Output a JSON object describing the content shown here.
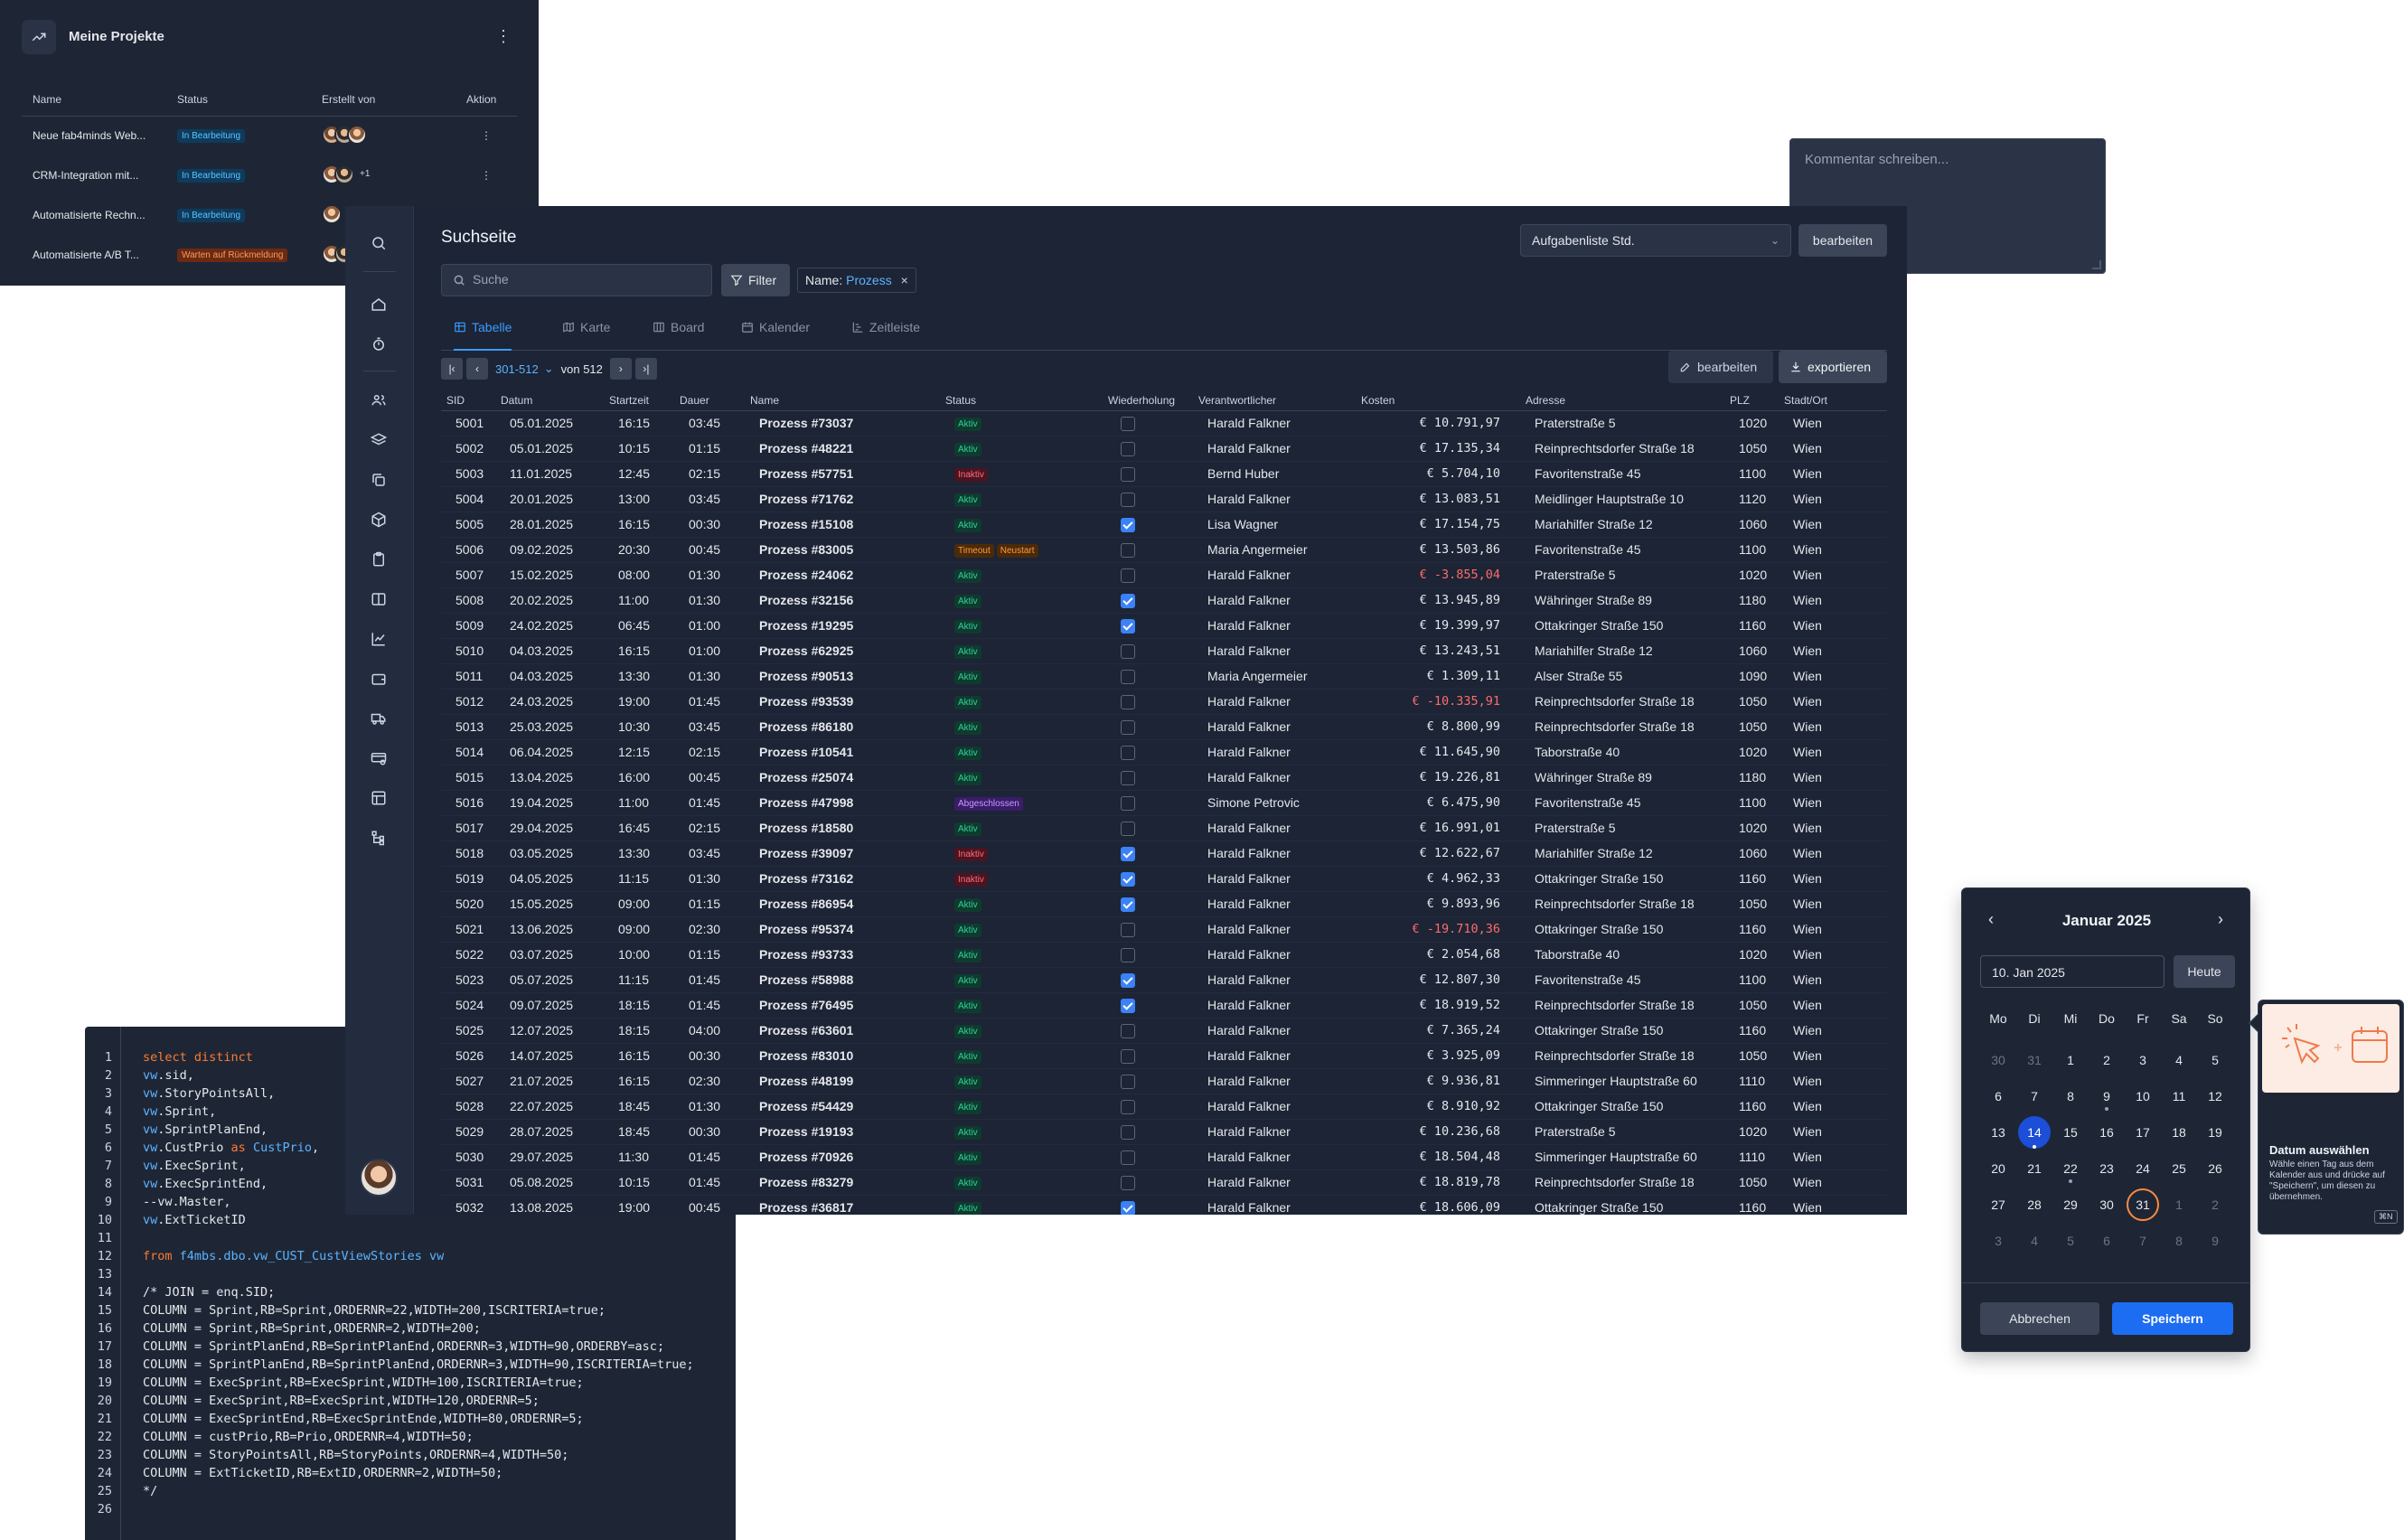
{
  "projects": {
    "title": "Meine Projekte",
    "columns": [
      "Name",
      "Status",
      "Erstellt von",
      "Aktion"
    ],
    "rows": [
      {
        "name": "Neue fab4minds Web...",
        "status": "In Bearbeitung",
        "status_color": "#5cc3ff",
        "more": ""
      },
      {
        "name": "CRM-Integration mit...",
        "status": "In Bearbeitung",
        "status_color": "#5cc3ff",
        "more": "+1"
      },
      {
        "name": "Automatisierte Rechn...",
        "status": "In Bearbeitung",
        "status_color": "#5cc3ff",
        "more": ""
      },
      {
        "name": "Automatisierte A/B T...",
        "status": "Warten auf Rückmeldung",
        "status_color": "#ff9a5c",
        "more": ""
      }
    ]
  },
  "comment": {
    "placeholder": "Kommentar schreiben..."
  },
  "code": {
    "lines": [
      [
        [
          "kw",
          "select distinct"
        ]
      ],
      [
        [
          "vw",
          "vw"
        ],
        [
          "t",
          ".sid,"
        ]
      ],
      [
        [
          "vw",
          "vw"
        ],
        [
          "t",
          ".StoryPointsAll,"
        ]
      ],
      [
        [
          "vw",
          "vw"
        ],
        [
          "t",
          ".Sprint,"
        ]
      ],
      [
        [
          "vw",
          "vw"
        ],
        [
          "t",
          ".SprintPlanEnd,"
        ]
      ],
      [
        [
          "vw",
          "vw"
        ],
        [
          "t",
          ".CustPrio "
        ],
        [
          "kw",
          "as"
        ],
        [
          "vw",
          " CustPrio"
        ],
        [
          "t",
          ","
        ]
      ],
      [
        [
          "vw",
          "vw"
        ],
        [
          "t",
          ".ExecSprint,"
        ]
      ],
      [
        [
          "vw",
          "vw"
        ],
        [
          "t",
          ".ExecSprintEnd,"
        ]
      ],
      [
        [
          "t",
          "--vw.Master,"
        ]
      ],
      [
        [
          "vw",
          "vw"
        ],
        [
          "t",
          ".ExtTicketID"
        ]
      ],
      [],
      [
        [
          "kw",
          "from "
        ],
        [
          "vw",
          "f4mbs.dbo.vw_CUST_CustViewStories vw"
        ]
      ],
      [],
      [
        [
          "t",
          "/* JOIN = enq.SID;"
        ]
      ],
      [
        [
          "t",
          "COLUMN = Sprint,RB=Sprint,ORDERNR=22,WIDTH=200,ISCRITERIA=true;"
        ]
      ],
      [
        [
          "t",
          "COLUMN = Sprint,RB=Sprint,ORDERNR=2,WIDTH=200;"
        ]
      ],
      [
        [
          "t",
          "COLUMN = SprintPlanEnd,RB=SprintPlanEnd,ORDERNR=3,WIDTH=90,ORDERBY=asc;"
        ]
      ],
      [
        [
          "t",
          "COLUMN = SprintPlanEnd,RB=SprintPlanEnd,ORDERNR=3,WIDTH=90,ISCRITERIA=true;"
        ]
      ],
      [
        [
          "t",
          "COLUMN = ExecSprint,RB=ExecSprint,WIDTH=100,ISCRITERIA=true;"
        ]
      ],
      [
        [
          "t",
          "COLUMN = ExecSprint,RB=ExecSprint,WIDTH=120,ORDERNR=5;"
        ]
      ],
      [
        [
          "t",
          "COLUMN = ExecSprintEnd,RB=ExecSprintEnde,WIDTH=80,ORDERNR=5;"
        ]
      ],
      [
        [
          "t",
          "COLUMN = custPrio,RB=Prio,ORDERNR=4,WIDTH=50;"
        ]
      ],
      [
        [
          "t",
          "COLUMN = StoryPointsAll,RB=StoryPoints,ORDERNR=4,WIDTH=50;"
        ]
      ],
      [
        [
          "t",
          "COLUMN = ExtTicketID,RB=ExtID,ORDERNR=2,WIDTH=50;"
        ]
      ],
      [
        [
          "t",
          "*/"
        ]
      ],
      []
    ]
  },
  "main": {
    "title": "Suchseite",
    "view_select": "Aufgabenliste Std.",
    "view_edit": "bearbeiten",
    "search_placeholder": "Suche",
    "filter_label": "Filter",
    "chip_key": "Name:",
    "chip_value": "Prozess",
    "chip_close": "×",
    "tabs": [
      "Tabelle",
      "Karte",
      "Board",
      "Kalender",
      "Zeitleiste"
    ],
    "pager": {
      "range": "301-512",
      "of": "von 512"
    },
    "edit_label": "bearbeiten",
    "export_label": "exportieren",
    "columns": [
      "SID",
      "Datum",
      "Startzeit",
      "Dauer",
      "Name",
      "Status",
      "Wiederholung",
      "Verantwortlicher",
      "Kosten",
      "Adresse",
      "PLZ",
      "Stadt/Ort"
    ],
    "rows": [
      [
        "5001",
        "05.01.2025",
        "16:15",
        "03:45",
        "Prozess #73037",
        [
          "Aktiv"
        ],
        false,
        "Harald Falkner",
        "€ 10.791,97",
        "Praterstraße 5",
        "1020",
        "Wien"
      ],
      [
        "5002",
        "05.01.2025",
        "10:15",
        "01:15",
        "Prozess #48221",
        [
          "Aktiv"
        ],
        false,
        "Harald Falkner",
        "€ 17.135,34",
        "Reinprechtsdorfer Straße 18",
        "1050",
        "Wien"
      ],
      [
        "5003",
        "11.01.2025",
        "12:45",
        "02:15",
        "Prozess #57751",
        [
          "Inaktiv"
        ],
        false,
        "Bernd Huber",
        "€ 5.704,10",
        "Favoritenstraße 45",
        "1100",
        "Wien"
      ],
      [
        "5004",
        "20.01.2025",
        "13:00",
        "03:45",
        "Prozess #71762",
        [
          "Aktiv"
        ],
        false,
        "Harald Falkner",
        "€ 13.083,51",
        "Meidlinger Hauptstraße 10",
        "1120",
        "Wien"
      ],
      [
        "5005",
        "28.01.2025",
        "16:15",
        "00:30",
        "Prozess #15108",
        [
          "Aktiv"
        ],
        true,
        "Lisa Wagner",
        "€ 17.154,75",
        "Mariahilfer Straße 12",
        "1060",
        "Wien"
      ],
      [
        "5006",
        "09.02.2025",
        "20:30",
        "00:45",
        "Prozess #83005",
        [
          "Timeout",
          "Neustart"
        ],
        false,
        "Maria Angermeier",
        "€ 13.503,86",
        "Favoritenstraße 45",
        "1100",
        "Wien"
      ],
      [
        "5007",
        "15.02.2025",
        "08:00",
        "01:30",
        "Prozess #24062",
        [
          "Aktiv"
        ],
        false,
        "Harald Falkner",
        "€ -3.855,04",
        "Praterstraße 5",
        "1020",
        "Wien"
      ],
      [
        "5008",
        "20.02.2025",
        "11:00",
        "01:30",
        "Prozess #32156",
        [
          "Aktiv"
        ],
        true,
        "Harald Falkner",
        "€ 13.945,89",
        "Währinger Straße 89",
        "1180",
        "Wien"
      ],
      [
        "5009",
        "24.02.2025",
        "06:45",
        "01:00",
        "Prozess #19295",
        [
          "Aktiv"
        ],
        true,
        "Harald Falkner",
        "€ 19.399,97",
        "Ottakringer Straße 150",
        "1160",
        "Wien"
      ],
      [
        "5010",
        "04.03.2025",
        "16:15",
        "01:00",
        "Prozess #62925",
        [
          "Aktiv"
        ],
        false,
        "Harald Falkner",
        "€ 13.243,51",
        "Mariahilfer Straße 12",
        "1060",
        "Wien"
      ],
      [
        "5011",
        "04.03.2025",
        "13:30",
        "01:30",
        "Prozess #90513",
        [
          "Aktiv"
        ],
        false,
        "Maria Angermeier",
        "€ 1.309,11",
        "Alser Straße 55",
        "1090",
        "Wien"
      ],
      [
        "5012",
        "24.03.2025",
        "19:00",
        "01:45",
        "Prozess #93539",
        [
          "Aktiv"
        ],
        false,
        "Harald Falkner",
        "€ -10.335,91",
        "Reinprechtsdorfer Straße 18",
        "1050",
        "Wien"
      ],
      [
        "5013",
        "25.03.2025",
        "10:30",
        "03:45",
        "Prozess #86180",
        [
          "Aktiv"
        ],
        false,
        "Harald Falkner",
        "€ 8.800,99",
        "Reinprechtsdorfer Straße 18",
        "1050",
        "Wien"
      ],
      [
        "5014",
        "06.04.2025",
        "12:15",
        "02:15",
        "Prozess #10541",
        [
          "Aktiv"
        ],
        false,
        "Harald Falkner",
        "€ 11.645,90",
        "Taborstraße 40",
        "1020",
        "Wien"
      ],
      [
        "5015",
        "13.04.2025",
        "16:00",
        "00:45",
        "Prozess #25074",
        [
          "Aktiv"
        ],
        false,
        "Harald Falkner",
        "€ 19.226,81",
        "Währinger Straße 89",
        "1180",
        "Wien"
      ],
      [
        "5016",
        "19.04.2025",
        "11:00",
        "01:45",
        "Prozess #47998",
        [
          "Abgeschlossen"
        ],
        false,
        "Simone Petrovic",
        "€ 6.475,90",
        "Favoritenstraße 45",
        "1100",
        "Wien"
      ],
      [
        "5017",
        "29.04.2025",
        "16:45",
        "02:15",
        "Prozess #18580",
        [
          "Aktiv"
        ],
        false,
        "Harald Falkner",
        "€ 16.991,01",
        "Praterstraße 5",
        "1020",
        "Wien"
      ],
      [
        "5018",
        "03.05.2025",
        "13:30",
        "03:45",
        "Prozess #39097",
        [
          "Inaktiv"
        ],
        true,
        "Harald Falkner",
        "€ 12.622,67",
        "Mariahilfer Straße 12",
        "1060",
        "Wien"
      ],
      [
        "5019",
        "04.05.2025",
        "11:15",
        "01:30",
        "Prozess #73162",
        [
          "Inaktiv"
        ],
        true,
        "Harald Falkner",
        "€ 4.962,33",
        "Ottakringer Straße 150",
        "1160",
        "Wien"
      ],
      [
        "5020",
        "15.05.2025",
        "09:00",
        "01:15",
        "Prozess #86954",
        [
          "Aktiv"
        ],
        true,
        "Harald Falkner",
        "€ 9.893,96",
        "Reinprechtsdorfer Straße 18",
        "1050",
        "Wien"
      ],
      [
        "5021",
        "13.06.2025",
        "09:00",
        "02:30",
        "Prozess #95374",
        [
          "Aktiv"
        ],
        false,
        "Harald Falkner",
        "€ -19.710,36",
        "Ottakringer Straße 150",
        "1160",
        "Wien"
      ],
      [
        "5022",
        "03.07.2025",
        "10:00",
        "01:15",
        "Prozess #93733",
        [
          "Aktiv"
        ],
        false,
        "Harald Falkner",
        "€ 2.054,68",
        "Taborstraße 40",
        "1020",
        "Wien"
      ],
      [
        "5023",
        "05.07.2025",
        "11:15",
        "01:45",
        "Prozess #58988",
        [
          "Aktiv"
        ],
        true,
        "Harald Falkner",
        "€ 12.807,30",
        "Favoritenstraße 45",
        "1100",
        "Wien"
      ],
      [
        "5024",
        "09.07.2025",
        "18:15",
        "01:45",
        "Prozess #76495",
        [
          "Aktiv"
        ],
        true,
        "Harald Falkner",
        "€ 18.919,52",
        "Reinprechtsdorfer Straße 18",
        "1050",
        "Wien"
      ],
      [
        "5025",
        "12.07.2025",
        "18:15",
        "04:00",
        "Prozess #63601",
        [
          "Aktiv"
        ],
        false,
        "Harald Falkner",
        "€ 7.365,24",
        "Ottakringer Straße 150",
        "1160",
        "Wien"
      ],
      [
        "5026",
        "14.07.2025",
        "16:15",
        "00:30",
        "Prozess #83010",
        [
          "Aktiv"
        ],
        false,
        "Harald Falkner",
        "€ 3.925,09",
        "Reinprechtsdorfer Straße 18",
        "1050",
        "Wien"
      ],
      [
        "5027",
        "21.07.2025",
        "16:15",
        "02:30",
        "Prozess #48199",
        [
          "Aktiv"
        ],
        false,
        "Harald Falkner",
        "€ 9.936,81",
        "Simmeringer Hauptstraße 60",
        "1110",
        "Wien"
      ],
      [
        "5028",
        "22.07.2025",
        "18:45",
        "01:30",
        "Prozess #54429",
        [
          "Aktiv"
        ],
        false,
        "Harald Falkner",
        "€ 8.910,92",
        "Ottakringer Straße 150",
        "1160",
        "Wien"
      ],
      [
        "5029",
        "28.07.2025",
        "18:45",
        "00:30",
        "Prozess #19193",
        [
          "Aktiv"
        ],
        false,
        "Harald Falkner",
        "€ 10.236,68",
        "Praterstraße 5",
        "1020",
        "Wien"
      ],
      [
        "5030",
        "29.07.2025",
        "11:30",
        "01:45",
        "Prozess #70926",
        [
          "Aktiv"
        ],
        false,
        "Harald Falkner",
        "€ 18.504,48",
        "Simmeringer Hauptstraße 60",
        "1110",
        "Wien"
      ],
      [
        "5031",
        "05.08.2025",
        "10:15",
        "01:45",
        "Prozess #83279",
        [
          "Aktiv"
        ],
        false,
        "Harald Falkner",
        "€ 18.819,78",
        "Reinprechtsdorfer Straße 18",
        "1050",
        "Wien"
      ],
      [
        "5032",
        "13.08.2025",
        "19:00",
        "00:45",
        "Prozess #36817",
        [
          "Aktiv"
        ],
        true,
        "Harald Falkner",
        "€ 18.606,09",
        "Ottakringer Straße 150",
        "1160",
        "Wien"
      ]
    ]
  },
  "datepicker": {
    "month": "Januar 2025",
    "prev": "‹",
    "next": "›",
    "input_value": "10. Jan 2025",
    "today_label": "Heute",
    "weekdays": [
      "Mo",
      "Di",
      "Mi",
      "Do",
      "Fr",
      "Sa",
      "So"
    ],
    "days": [
      [
        "30",
        "m"
      ],
      [
        "31",
        "m"
      ],
      [
        "1",
        ""
      ],
      [
        "2",
        ""
      ],
      [
        "3",
        ""
      ],
      [
        "4",
        ""
      ],
      [
        "5",
        ""
      ],
      [
        "6",
        ""
      ],
      [
        "7",
        ""
      ],
      [
        "8",
        ""
      ],
      [
        "9",
        "d"
      ],
      [
        "10",
        ""
      ],
      [
        "11",
        ""
      ],
      [
        "12",
        ""
      ],
      [
        "13",
        ""
      ],
      [
        "14",
        "sd"
      ],
      [
        "15",
        ""
      ],
      [
        "16",
        ""
      ],
      [
        "17",
        ""
      ],
      [
        "18",
        ""
      ],
      [
        "19",
        ""
      ],
      [
        "20",
        ""
      ],
      [
        "21",
        ""
      ],
      [
        "22",
        "d"
      ],
      [
        "23",
        ""
      ],
      [
        "24",
        ""
      ],
      [
        "25",
        ""
      ],
      [
        "26",
        ""
      ],
      [
        "27",
        ""
      ],
      [
        "28",
        ""
      ],
      [
        "29",
        ""
      ],
      [
        "30",
        ""
      ],
      [
        "31",
        "t"
      ],
      [
        "1",
        "m"
      ],
      [
        "2",
        "m"
      ],
      [
        "3",
        "m"
      ],
      [
        "4",
        "m"
      ],
      [
        "5",
        "m"
      ],
      [
        "6",
        "m"
      ],
      [
        "7",
        "m"
      ],
      [
        "8",
        "m"
      ],
      [
        "9",
        "m"
      ]
    ],
    "cancel_label": "Abbrechen",
    "save_label": "Speichern"
  },
  "tooltip": {
    "title": "Datum auswählen",
    "body": "Wähle einen Tag aus dem Kalender aus und drücke auf \"Speichern\", um diesen zu übernehmen.",
    "kbd": "⌘N"
  },
  "colors": {
    "accent": "#3b82f6",
    "bg": "#1c2435",
    "negative": "#ff6b6b",
    "today_ring": "#ff8a3c"
  }
}
